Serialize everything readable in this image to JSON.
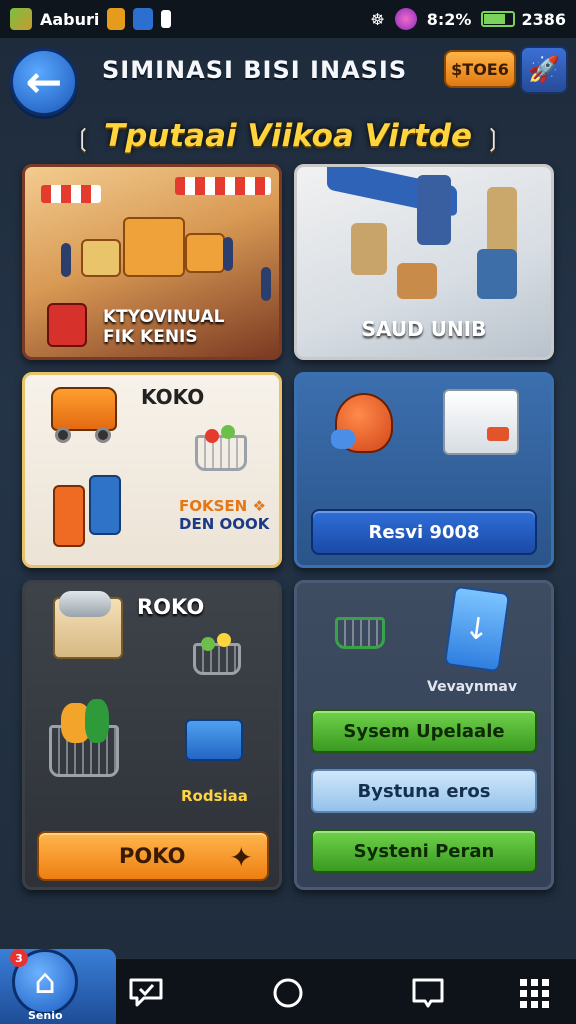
{
  "statusbar": {
    "carrier": "Aaburi",
    "time": "8:2%",
    "battery_value": "2386",
    "battery_level_percent": 70
  },
  "header": {
    "title": "SIMINASI BISI INASIS",
    "coin_label": "$TOE6",
    "subtitle": "Tputaai Viikoa Virtde",
    "subtitle_deco_left": "❲",
    "subtitle_deco_right": "❳"
  },
  "cards": {
    "market": {
      "label_line1": "KTYOVINUAL",
      "label_line2": "FIK KENIS"
    },
    "warehouse": {
      "label": "SAUD UNIB"
    },
    "store": {
      "label": "KOKO",
      "sub_line1": "FOKSEN",
      "sub_line1_mark": "❖",
      "sub_line2": "DEN OOOK"
    },
    "reserve": {
      "button": "Resvi 9008"
    },
    "shop": {
      "label": "ROKO",
      "sub": "Rodsiaa",
      "button": "POKO"
    },
    "system": {
      "sub": "Vevaynmav",
      "btn_update": "Sysem Upelaale",
      "btn_middle": "Bystuna eros",
      "btn_bottom": "Systeni Peran"
    }
  },
  "bottomnav": {
    "home_label": "Senio",
    "home_badge": "3"
  },
  "colors": {
    "accent_orange": "#ee7f12",
    "accent_blue": "#1a56b8",
    "accent_green": "#3a9a22",
    "title_yellow": "#ffd43c"
  },
  "icons": {
    "back": "arrow-left-icon",
    "tool": "rocket-icon",
    "home": "home-icon",
    "chat": "chat-check-icon",
    "circle": "circle-icon",
    "square": "square-icon",
    "grid": "grid-icon"
  }
}
